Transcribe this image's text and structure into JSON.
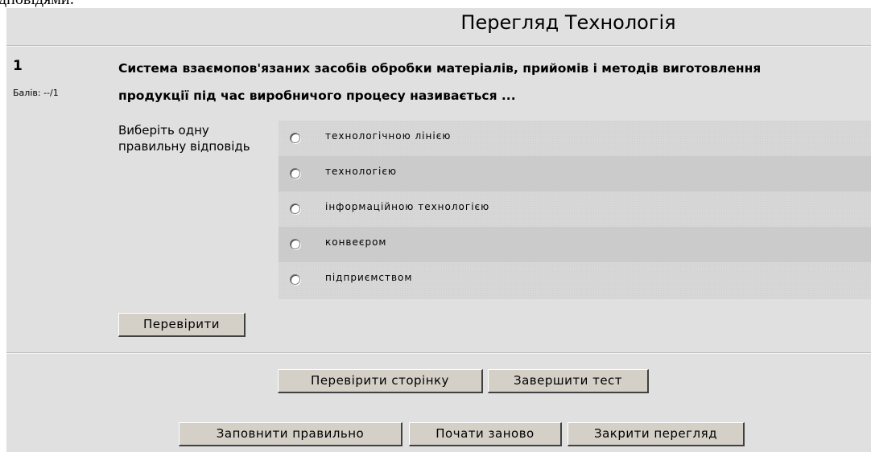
{
  "cropped_text": "дповідями:",
  "page_title": "Перегляд Технологія",
  "question": {
    "number": "1",
    "grade": "Балів: --/1",
    "line1": "Система взаємопов'язаних засобів обробки матеріалів, прийомів і методів виготовлення",
    "line2": "продукції під  час виробничого  процесу називається ...",
    "prompt": "Виберіть одну правильну відповідь",
    "answers": [
      {
        "label": "технологічною лінією",
        "selected": false
      },
      {
        "label": "технологією",
        "selected": false
      },
      {
        "label": "інформаційною технологією",
        "selected": false
      },
      {
        "label": "конвеєром",
        "selected": false
      },
      {
        "label": "підприємством",
        "selected": false
      }
    ],
    "check_button": "Перевірити"
  },
  "controls": {
    "check_page": "Перевірити сторінку",
    "finish_test": "Завершити тест",
    "fill_correct": "Заповнити правильно",
    "start_again": "Почати заново",
    "close_preview": "Закрити перегляд"
  }
}
